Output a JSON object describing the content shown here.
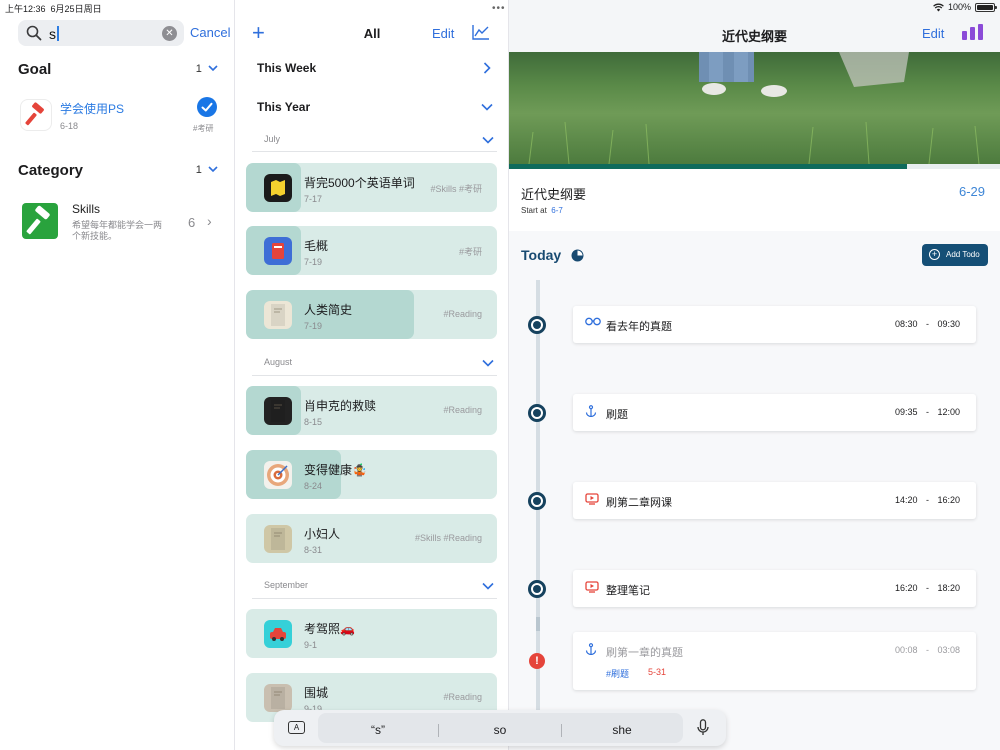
{
  "status": {
    "time": "上午12:36",
    "date": "6月25日周日",
    "battery": "100%"
  },
  "left": {
    "search_value": "s",
    "cancel": "Cancel",
    "goal_section": {
      "title": "Goal",
      "count": "1"
    },
    "goal": {
      "title": "学会使用PS",
      "date": "6-18",
      "tag": "#考研"
    },
    "category_section": {
      "title": "Category",
      "count": "1"
    },
    "category": {
      "title": "Skills",
      "desc": "希望每年都能学会一两个新技能。",
      "count": "6"
    }
  },
  "middle": {
    "title": "All",
    "edit": "Edit",
    "this_week": "This Week",
    "this_year": "This Year",
    "months": [
      "July",
      "August",
      "September"
    ],
    "cards": [
      {
        "title": "背完5000个英语单词",
        "date": "7-17",
        "tag": "#Skills #考研",
        "progress": 0.22,
        "icon": "map-icon",
        "color": "#1b1b1b"
      },
      {
        "title": "毛概",
        "date": "7-19",
        "tag": "#考研",
        "progress": 0.22,
        "icon": "book-icon",
        "color": "#3e6ed6"
      },
      {
        "title": "人类简史",
        "date": "7-19",
        "tag": "#Reading",
        "progress": 0.67,
        "icon": "book-cover-icon",
        "color": "#ece6d6"
      },
      {
        "title": "肖申克的救赎",
        "date": "8-15",
        "tag": "#Reading",
        "progress": 0.22,
        "icon": "book-cover-icon",
        "color": "#222222"
      },
      {
        "title": "变得健康🤹",
        "date": "8-24",
        "tag": "",
        "progress": 0.38,
        "icon": "target-icon",
        "color": "#f3f1ec"
      },
      {
        "title": "小妇人",
        "date": "8-31",
        "tag": "#Skills #Reading",
        "progress": 0,
        "icon": "book-cover-icon",
        "color": "#cfc7a6"
      },
      {
        "title": "考驾照🚗",
        "date": "9-1",
        "tag": "",
        "progress": 0,
        "icon": "car-icon",
        "color": "#35d0d8"
      },
      {
        "title": "围城",
        "date": "9-19",
        "tag": "#Reading",
        "progress": 0,
        "icon": "book-cover-icon",
        "color": "#c9bfb0"
      }
    ]
  },
  "right": {
    "title": "近代史纲要",
    "edit": "Edit",
    "goal_name": "近代史纲要",
    "start_label": "Start at",
    "start_date": "6-7",
    "due": "6-29",
    "progress": 0.81,
    "today": "Today",
    "add_todo": "Add Todo",
    "todos": [
      {
        "name": "看去年的真题",
        "start": "08:30",
        "end": "09:30",
        "icon": "glasses-icon",
        "icon_color": "#2f6fdc"
      },
      {
        "name": "刷题",
        "start": "09:35",
        "end": "12:00",
        "icon": "anchor-icon",
        "icon_color": "#2f6fdc"
      },
      {
        "name": "刷第二章网课",
        "start": "14:20",
        "end": "16:20",
        "icon": "video-icon",
        "icon_color": "#e5443a"
      },
      {
        "name": "整理笔记",
        "start": "16:20",
        "end": "18:20",
        "icon": "video-icon",
        "icon_color": "#e5443a"
      },
      {
        "name": "刷第一章的真题",
        "start": "00:08",
        "end": "03:08",
        "icon": "anchor-icon",
        "icon_color": "#2f6fdc",
        "tag": "#刷题",
        "date": "5-31"
      }
    ]
  },
  "keyboard": {
    "suggestions": [
      "“s”",
      "so",
      "she"
    ]
  }
}
